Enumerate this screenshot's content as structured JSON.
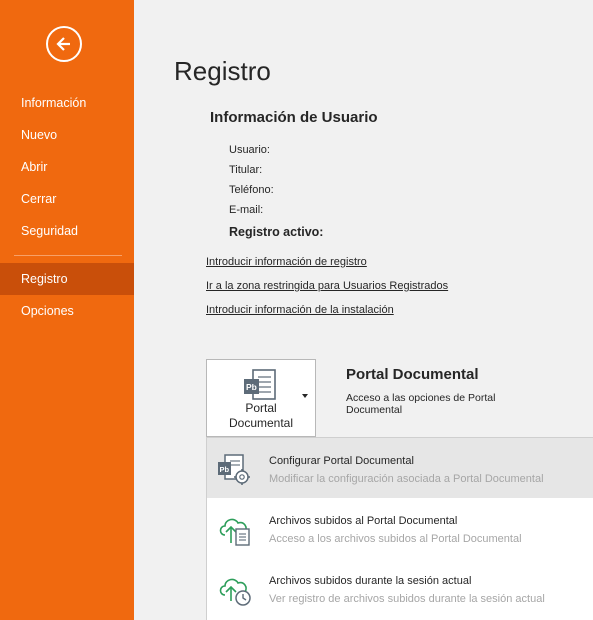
{
  "sidebar": {
    "back_icon": "arrow-left-icon",
    "items": [
      {
        "label": "Información"
      },
      {
        "label": "Nuevo"
      },
      {
        "label": "Abrir"
      },
      {
        "label": "Cerrar"
      },
      {
        "label": "Seguridad"
      },
      {
        "label": "Registro",
        "active": true
      },
      {
        "label": "Opciones"
      }
    ]
  },
  "main": {
    "title": "Registro",
    "user_info": {
      "heading": "Información de Usuario",
      "fields": [
        {
          "label": "Usuario:"
        },
        {
          "label": "Titular:"
        },
        {
          "label": "Teléfono:"
        },
        {
          "label": "E-mail:"
        }
      ],
      "active_label": "Registro activo:"
    },
    "links": [
      "Introducir información de registro",
      "Ir a la zona restringida para Usuarios Registrados",
      "Introducir información de la instalación"
    ],
    "portal": {
      "button_label_1": "Portal",
      "button_label_2": "Documental",
      "title": "Portal Documental",
      "description": "Acceso a las opciones de Portal Documental",
      "menu": [
        {
          "title": "Configurar Portal Documental",
          "description": "Modificar la configuración asociada a Portal Documental",
          "icon": "portal-settings-icon"
        },
        {
          "title": "Archivos subidos al Portal Documental",
          "description": "Acceso a los archivos subidos al Portal Documental",
          "icon": "cloud-upload-document-icon"
        },
        {
          "title": "Archivos subidos durante la sesión actual",
          "description": "Ver registro de archivos subidos durante la sesión actual",
          "icon": "cloud-upload-history-icon"
        }
      ]
    }
  },
  "colors": {
    "accent": "#f0690f",
    "sidebar_active": "#c94f0a",
    "icon_green": "#2e9e5b",
    "icon_slate": "#5d6b78"
  }
}
